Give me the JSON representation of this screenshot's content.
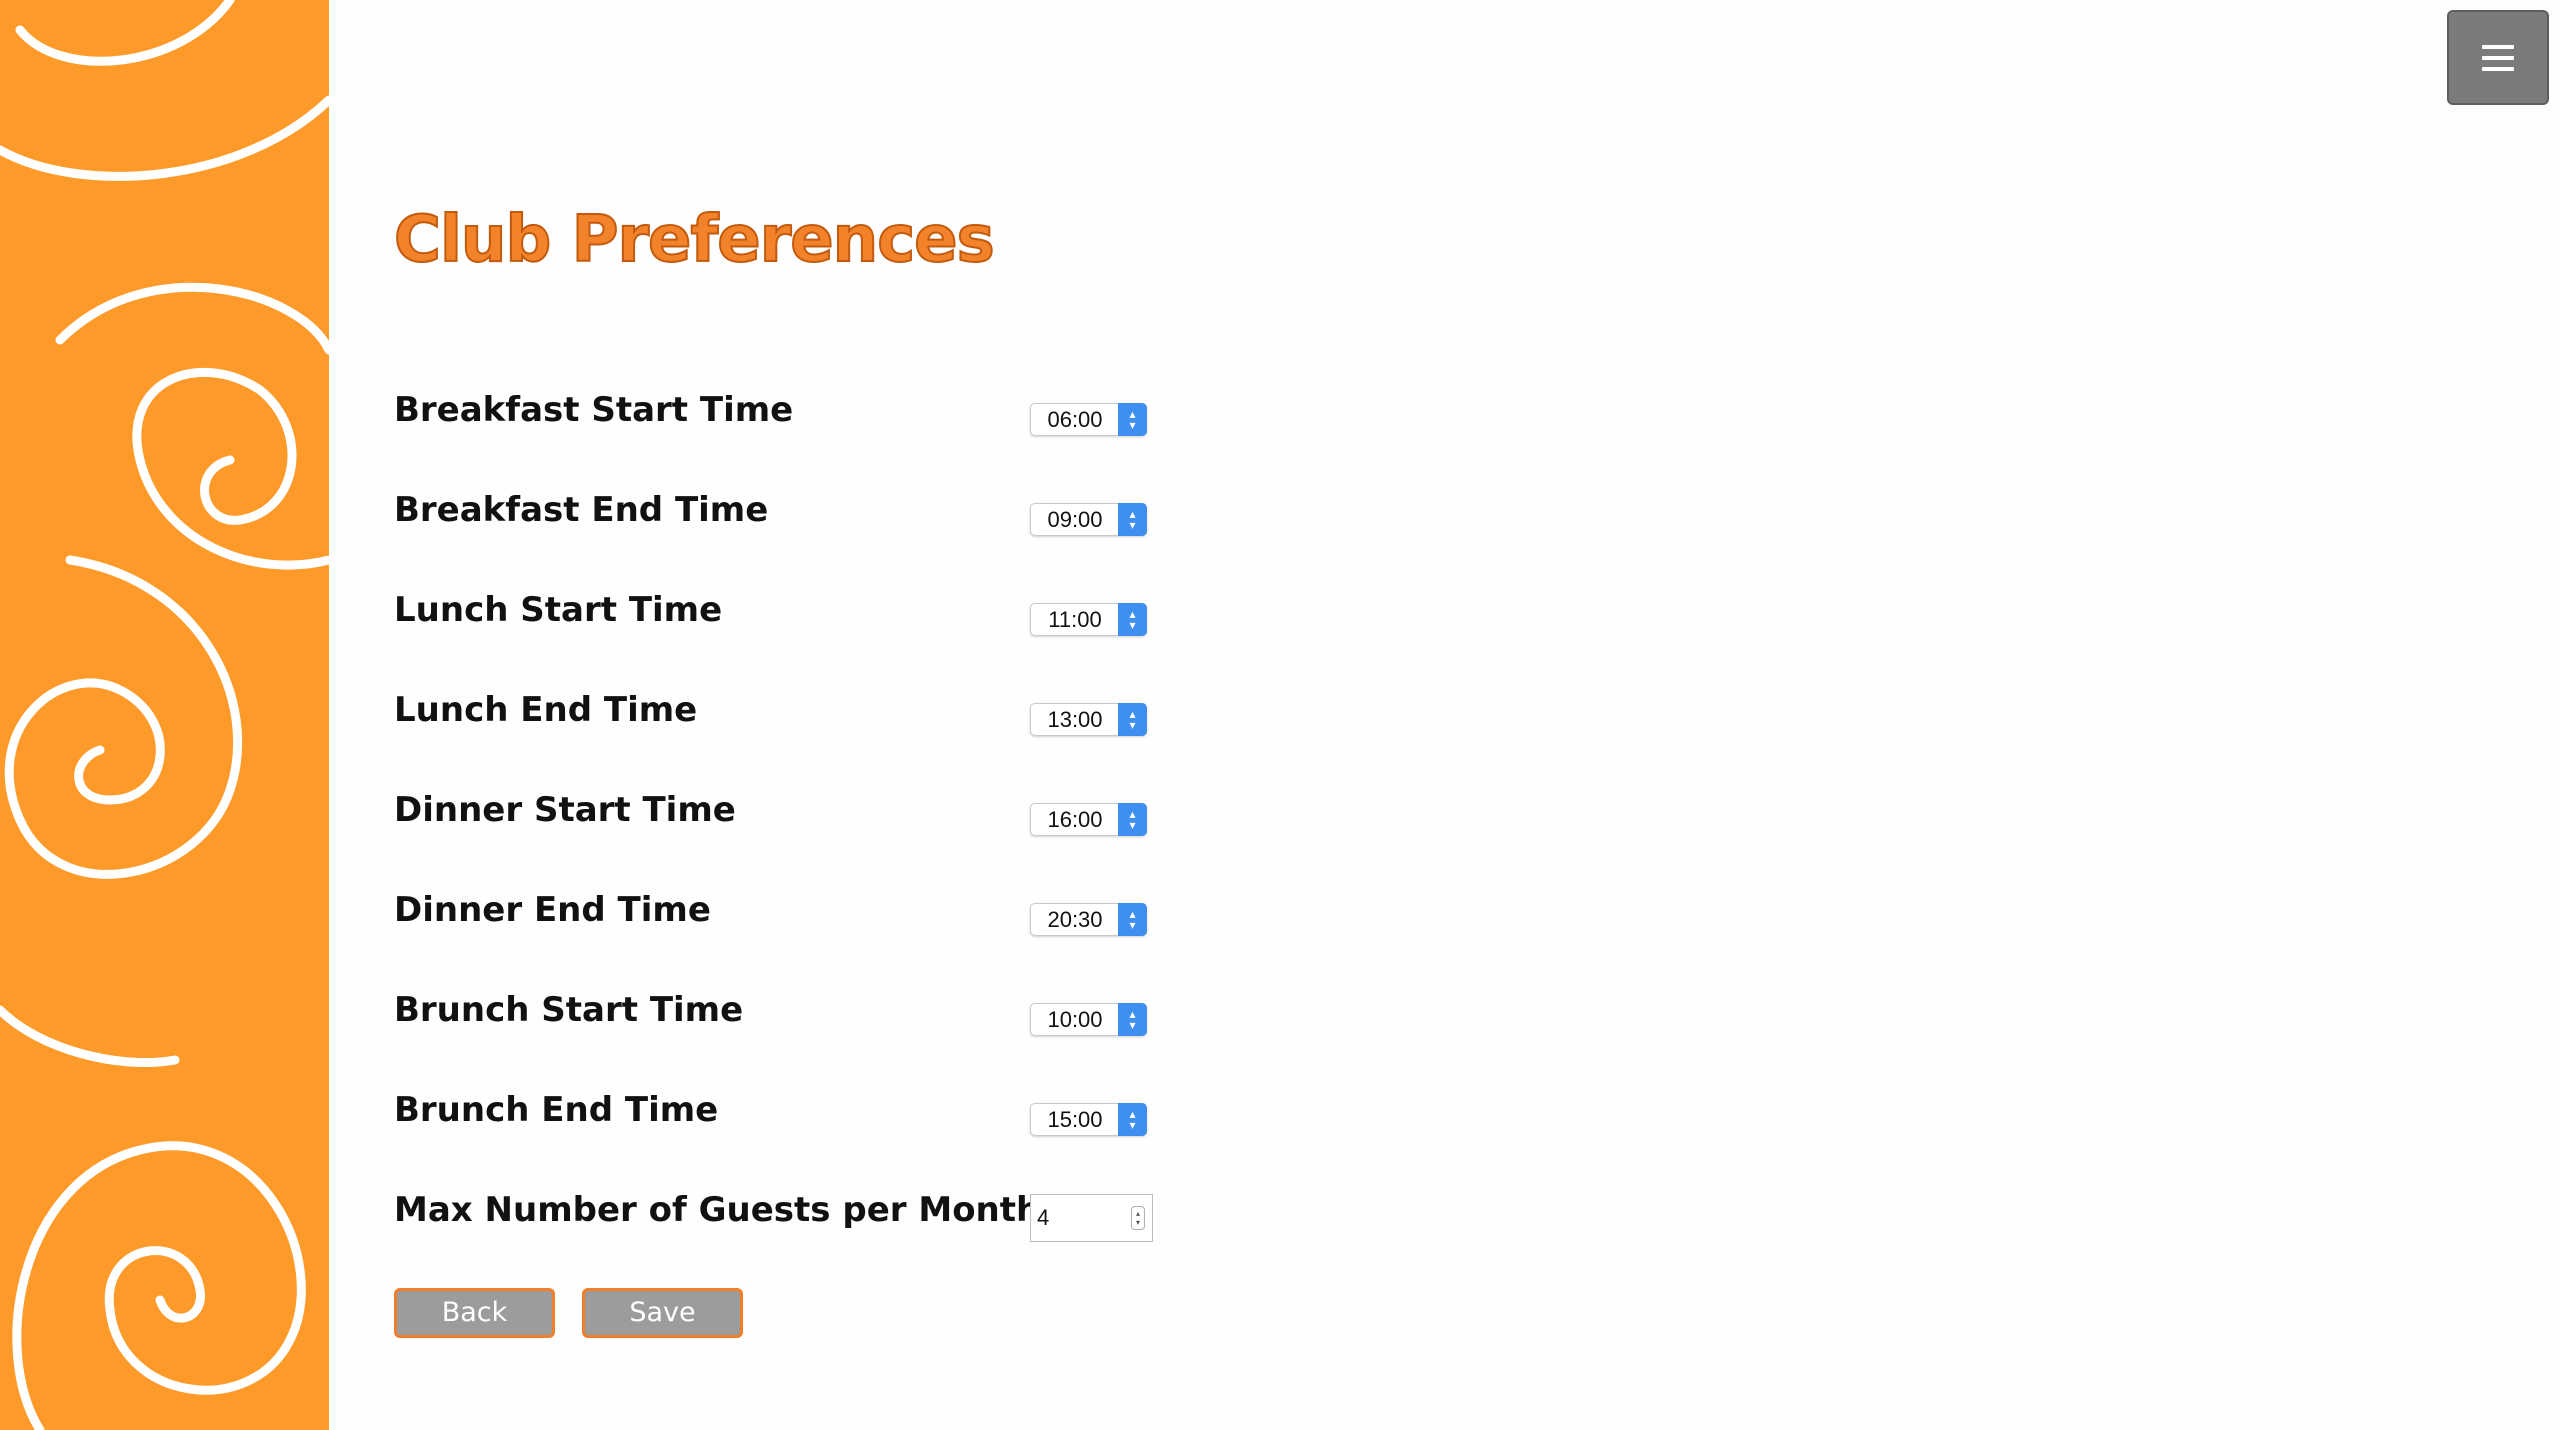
{
  "header": {
    "menu_icon": "hamburger-menu-icon"
  },
  "page": {
    "title": "Club Preferences"
  },
  "preferences": [
    {
      "label": "Breakfast Start Time",
      "value": "06:00"
    },
    {
      "label": "Breakfast End Time",
      "value": "09:00"
    },
    {
      "label": "Lunch Start Time",
      "value": "11:00"
    },
    {
      "label": "Lunch End Time",
      "value": "13:00"
    },
    {
      "label": "Dinner Start Time",
      "value": "16:00"
    },
    {
      "label": "Dinner End Time",
      "value": "20:30"
    },
    {
      "label": "Brunch Start Time",
      "value": "10:00"
    },
    {
      "label": "Brunch End Time",
      "value": "15:00"
    }
  ],
  "guests": {
    "label": "Max Number of Guests per Month:",
    "value": "4"
  },
  "actions": {
    "back_label": "Back",
    "save_label": "Save"
  },
  "colors": {
    "brand_orange": "#fd9a2a",
    "title_orange": "#f2832a",
    "select_accent": "#3f8ff0",
    "button_gray": "#9c9c9c"
  }
}
